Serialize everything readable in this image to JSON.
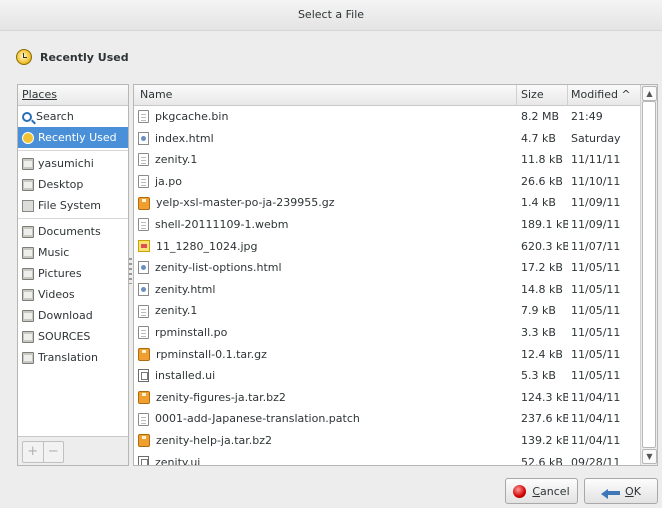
{
  "window": {
    "title": "Select a File"
  },
  "location": {
    "label": "Recently Used",
    "icon": "recently-used-icon"
  },
  "places": {
    "header": "Places",
    "groups": [
      [
        {
          "label": "Search",
          "icon": "search-icon",
          "selected": false
        },
        {
          "label": "Recently Used",
          "icon": "recently-used-icon",
          "selected": true
        }
      ],
      [
        {
          "label": "yasumichi",
          "icon": "home-folder-icon",
          "selected": false
        },
        {
          "label": "Desktop",
          "icon": "desktop-folder-icon",
          "selected": false
        },
        {
          "label": "File System",
          "icon": "drive-icon",
          "selected": false
        }
      ],
      [
        {
          "label": "Documents",
          "icon": "folder-icon",
          "selected": false
        },
        {
          "label": "Music",
          "icon": "folder-icon",
          "selected": false
        },
        {
          "label": "Pictures",
          "icon": "folder-icon",
          "selected": false
        },
        {
          "label": "Videos",
          "icon": "folder-icon",
          "selected": false
        },
        {
          "label": "Download",
          "icon": "folder-icon",
          "selected": false
        },
        {
          "label": "SOURCES",
          "icon": "folder-icon",
          "selected": false
        },
        {
          "label": "Translation",
          "icon": "folder-icon",
          "selected": false
        }
      ]
    ],
    "add_label": "+",
    "remove_label": "−"
  },
  "files": {
    "columns": {
      "name": "Name",
      "size": "Size",
      "modified": "Modified ^"
    },
    "rows": [
      {
        "name": "pkgcache.bin",
        "size": "8.2 MB",
        "modified": "21:49",
        "icon": "doc"
      },
      {
        "name": "index.html",
        "size": "4.7 kB",
        "modified": "Saturday",
        "icon": "html"
      },
      {
        "name": "zenity.1",
        "size": "11.8 kB",
        "modified": "11/11/11",
        "icon": "doc"
      },
      {
        "name": "ja.po",
        "size": "26.6 kB",
        "modified": "11/10/11",
        "icon": "doc"
      },
      {
        "name": "yelp-xsl-master-po-ja-239955.gz",
        "size": "1.4 kB",
        "modified": "11/09/11",
        "icon": "archive"
      },
      {
        "name": "shell-20111109-1.webm",
        "size": "189.1 kB",
        "modified": "11/09/11",
        "icon": "doc"
      },
      {
        "name": "11_1280_1024.jpg",
        "size": "620.3 kB",
        "modified": "11/07/11",
        "icon": "image"
      },
      {
        "name": "zenity-list-options.html",
        "size": "17.2 kB",
        "modified": "11/05/11",
        "icon": "html"
      },
      {
        "name": "zenity.html",
        "size": "14.8 kB",
        "modified": "11/05/11",
        "icon": "html"
      },
      {
        "name": "zenity.1",
        "size": "7.9 kB",
        "modified": "11/05/11",
        "icon": "doc"
      },
      {
        "name": "rpminstall.po",
        "size": "3.3 kB",
        "modified": "11/05/11",
        "icon": "doc"
      },
      {
        "name": "rpminstall-0.1.tar.gz",
        "size": "12.4 kB",
        "modified": "11/05/11",
        "icon": "archive"
      },
      {
        "name": "installed.ui",
        "size": "5.3 kB",
        "modified": "11/05/11",
        "icon": "ui"
      },
      {
        "name": "zenity-figures-ja.tar.bz2",
        "size": "124.3 kB",
        "modified": "11/04/11",
        "icon": "archive"
      },
      {
        "name": "0001-add-Japanese-translation.patch",
        "size": "237.6 kB",
        "modified": "11/04/11",
        "icon": "doc"
      },
      {
        "name": "zenity-help-ja.tar.bz2",
        "size": "139.2 kB",
        "modified": "11/04/11",
        "icon": "archive"
      },
      {
        "name": "zenity.ui",
        "size": "52.6 kB",
        "modified": "09/28/11",
        "icon": "ui"
      }
    ]
  },
  "buttons": {
    "cancel": "Cancel",
    "ok": "OK"
  }
}
